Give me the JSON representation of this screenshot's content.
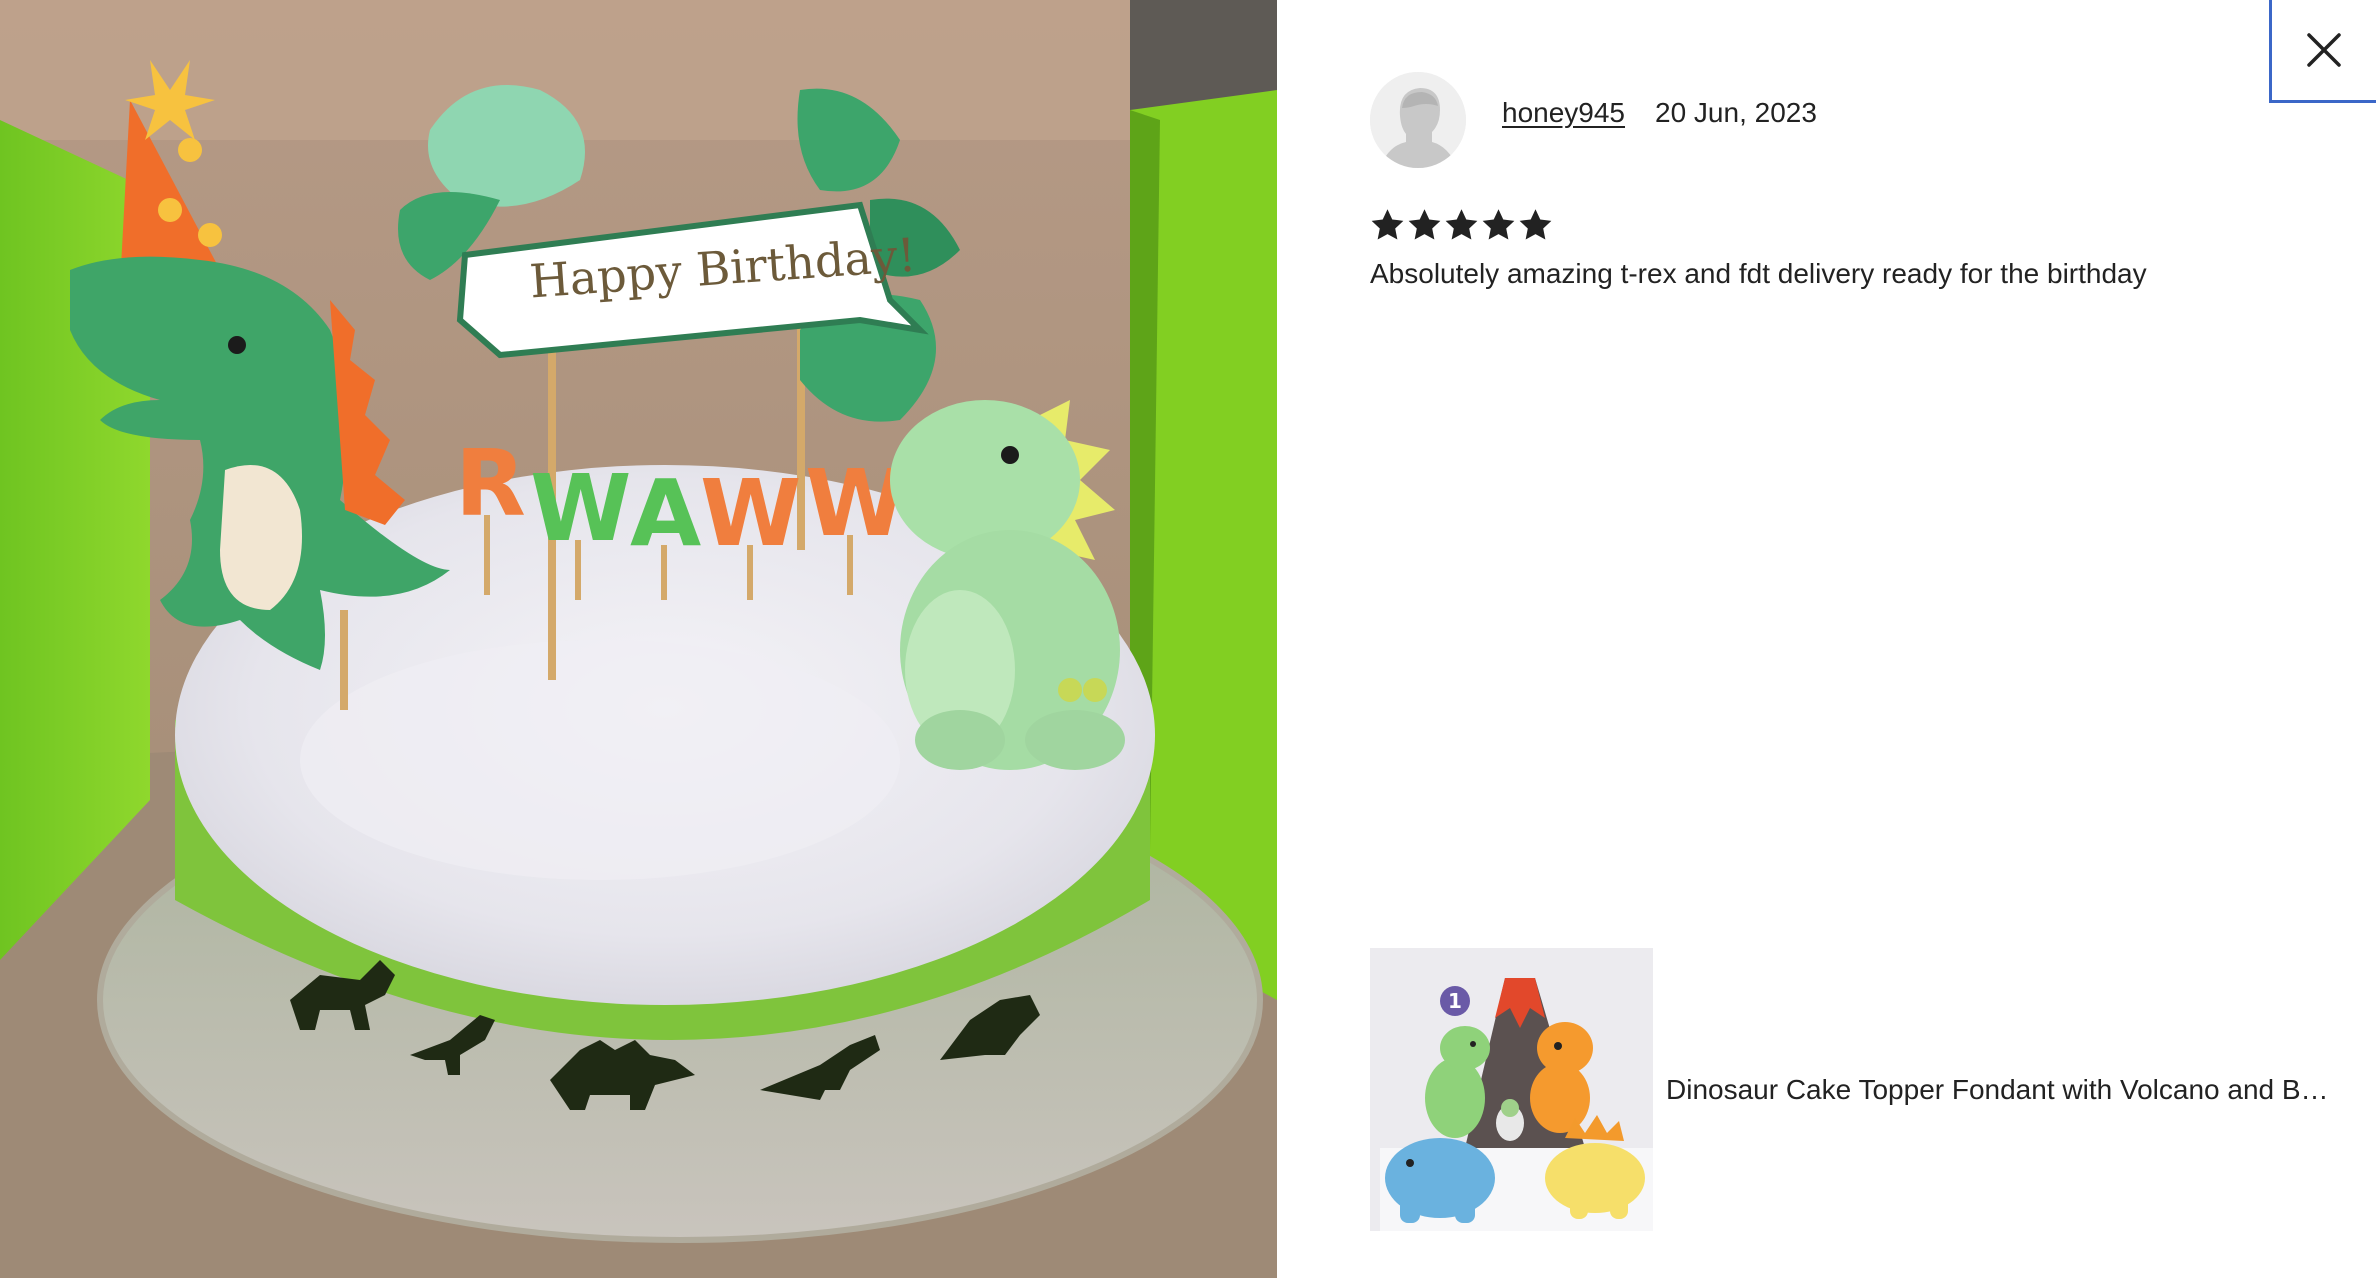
{
  "modal": {
    "close_icon": "close-icon",
    "accent_color": "#3b67c8"
  },
  "photo": {
    "banner_text": "Happy Birthday!",
    "candle_letters": [
      "R",
      "W",
      "A",
      "W",
      "W"
    ]
  },
  "review": {
    "avatar_icon": "user-silhouette-icon",
    "reviewer_name": "honey945",
    "date": "20 Jun, 2023",
    "rating": 5,
    "rating_max": 5,
    "star_icon": "star-icon",
    "text": "Absolutely amazing t-rex and fdt delivery ready for the birthday"
  },
  "product": {
    "title": "Dinosaur Cake Topper Fondant with Volcano and B…",
    "thumb_badge": "1"
  }
}
